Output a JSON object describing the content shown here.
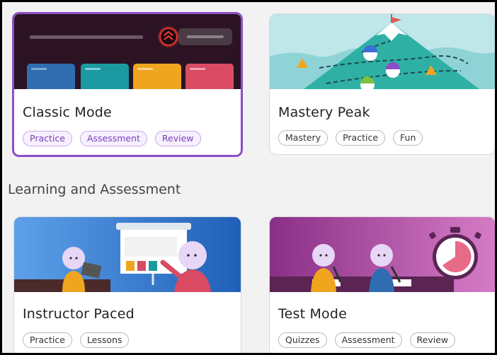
{
  "section_heading": "Learning and Assessment",
  "cards": [
    {
      "title": "Classic Mode",
      "tags": [
        "Practice",
        "Assessment",
        "Review"
      ],
      "selected": true,
      "illustration": "classic-mode-illustration"
    },
    {
      "title": "Mastery Peak",
      "tags": [
        "Mastery",
        "Practice",
        "Fun"
      ],
      "illustration": "mountain-climb-illustration"
    },
    {
      "title": "Instructor Paced",
      "tags": [
        "Practice",
        "Lessons"
      ],
      "illustration": "presentation-board-illustration"
    },
    {
      "title": "Test Mode",
      "tags": [
        "Quizzes",
        "Assessment",
        "Review"
      ],
      "illustration": "stopwatch-illustration"
    }
  ],
  "colors": {
    "selected_border": "#8a4fc6",
    "tag_accent": "#7a3fb8"
  }
}
